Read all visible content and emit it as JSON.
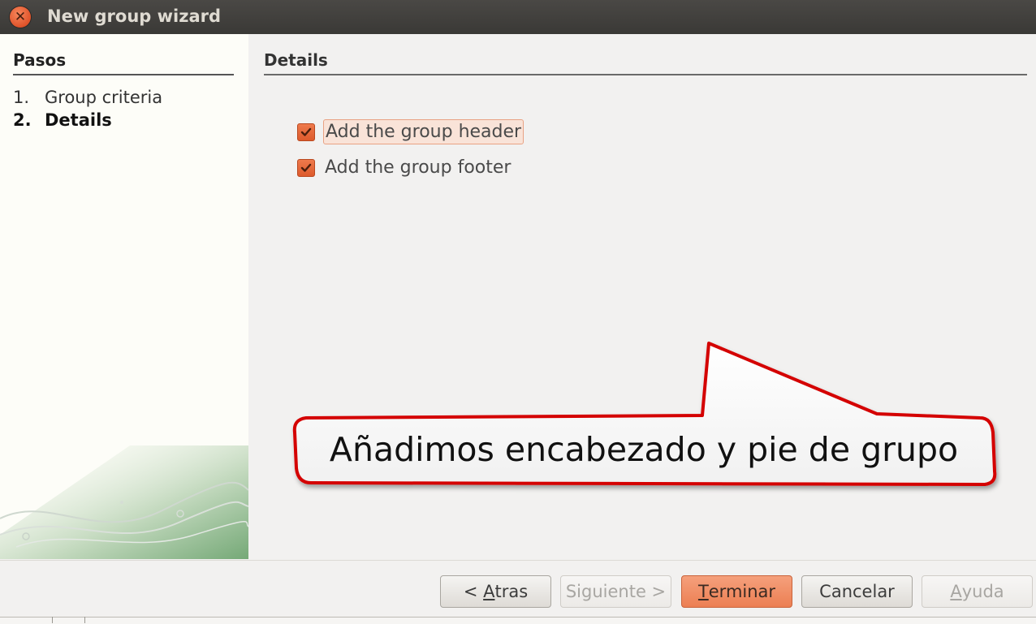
{
  "window": {
    "title": "New group wizard"
  },
  "steps": {
    "heading": "Pasos",
    "items": [
      {
        "number": "1.",
        "label": "Group criteria",
        "current": false
      },
      {
        "number": "2.",
        "label": "Details",
        "current": true
      }
    ]
  },
  "details": {
    "heading": "Details",
    "options": [
      {
        "label": "Add the group header",
        "checked": true
      },
      {
        "label": "Add the group footer",
        "checked": true
      }
    ]
  },
  "callout": {
    "text": "Añadimos encabezado y pie de grupo"
  },
  "buttons": {
    "back_prefix": "< ",
    "back_mnemonic": "A",
    "back_rest": "tras",
    "next": "Siguiente >",
    "finish_mnemonic": "T",
    "finish_rest": "erminar",
    "cancel": "Cancelar",
    "help_mnemonic": "A",
    "help_rest": "yuda"
  },
  "colors": {
    "accent": "#ec7f53",
    "titlebar": "#3c3b37",
    "callout_border": "#d40000"
  },
  "icons": {
    "close": "close-icon",
    "check": "checkmark-icon"
  }
}
